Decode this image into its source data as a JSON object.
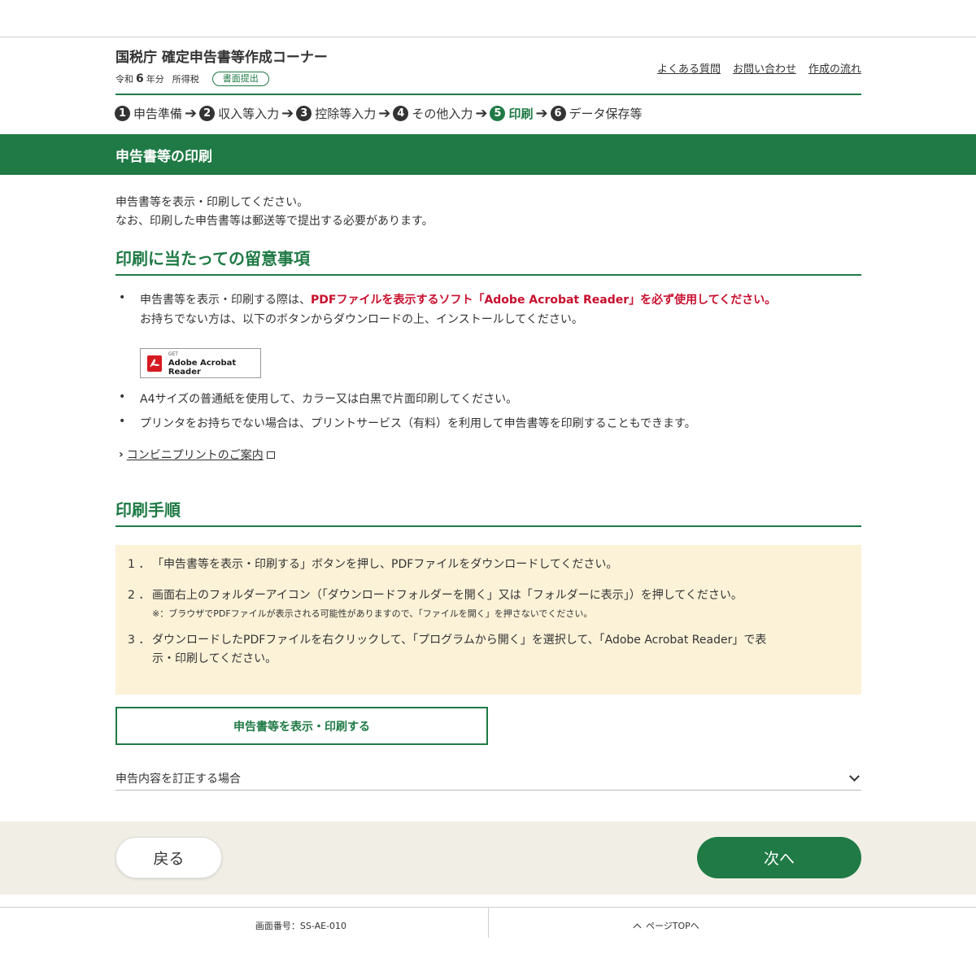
{
  "header": {
    "site_title": "国税庁 確定申告書等作成コーナー",
    "era": "令和",
    "year": "6",
    "year_suffix": "年分",
    "tax_type": "所得税",
    "badge": "書面提出",
    "links": [
      "よくある質問",
      "お問い合わせ",
      "作成の流れ"
    ]
  },
  "steps": [
    {
      "num": "1",
      "label": "申告準備"
    },
    {
      "num": "2",
      "label": "収入等入力"
    },
    {
      "num": "3",
      "label": "控除等入力"
    },
    {
      "num": "4",
      "label": "その他入力"
    },
    {
      "num": "5",
      "label": "印刷"
    },
    {
      "num": "6",
      "label": "データ保存等"
    }
  ],
  "page_title": "申告書等の印刷",
  "intro": {
    "line1": "申告書等を表示・印刷してください。",
    "line2": "なお、印刷した申告書等は郵送等で提出する必要があります。"
  },
  "notes": {
    "heading": "印刷に当たっての留意事項",
    "bullet1_prefix": "申告書等を表示・印刷する際は、",
    "bullet1_red": "PDFファイルを表示するソフト「Adobe Acrobat Reader」を必ず使用してください。",
    "bullet1_line2": "お持ちでない方は、以下のボタンからダウンロードの上、インストールしてください。",
    "acrobat_get": "GET",
    "acrobat_name": "Adobe Acrobat Reader",
    "bullet2": "A4サイズの普通紙を使用して、カラー又は白黒で片面印刷してください。",
    "bullet3": "プリンタをお持ちでない場合は、プリントサービス（有料）を利用して申告書等を印刷することもできます。",
    "link": "コンビニプリントのご案内"
  },
  "procedure": {
    "heading": "印刷手順",
    "items": [
      {
        "n": "1 ．",
        "text": "「申告書等を表示・印刷する」ボタンを押し、PDFファイルをダウンロードしてください。"
      },
      {
        "n": "2 ．",
        "text": "画面右上のフォルダーアイコン（「ダウンロードフォルダーを開く」又は「フォルダーに表示」）を押してください。"
      },
      {
        "n": "3 ．",
        "text": "ダウンロードしたPDFファイルを右クリックして、「プログラムから開く」を選択して、「Adobe Acrobat Reader」で表",
        "text2": "示・印刷してください。"
      }
    ],
    "note": "※：ブラウザでPDFファイルが表示される可能性がありますので、「ファイルを開く」を押さないでください。"
  },
  "print_button": "申告書等を表示・印刷する",
  "accordion": "申告内容を訂正する場合",
  "nav": {
    "back": "戻る",
    "next": "次へ"
  },
  "footer": {
    "screen_no": "画面番号：SS-AE-010",
    "page_top": "ページTOPへ"
  },
  "colors": {
    "primary": "#1f7a45",
    "alert": "#c8102e",
    "procedure_bg": "#fcf2d8",
    "footer_bg": "#f1efe5"
  }
}
